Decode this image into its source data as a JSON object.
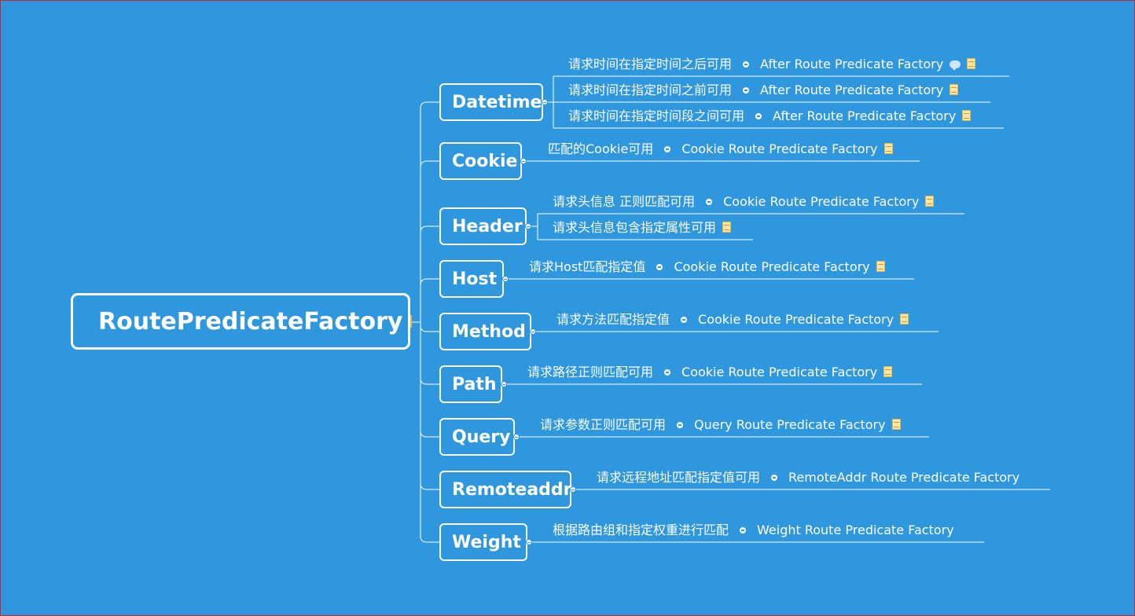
{
  "root": {
    "label": "RoutePredicateFactory",
    "has_note": true
  },
  "branches": [
    {
      "label": "Datetime",
      "items": [
        {
          "text": "请求时间在指定时间之后可用",
          "factory": "After Route Predicate Factory",
          "icons": [
            "comment-icon",
            "note-icon"
          ]
        },
        {
          "text": "请求时间在指定时间之前可用",
          "factory": "After Route Predicate Factory",
          "icons": [
            "note-icon"
          ]
        },
        {
          "text": "请求时间在指定时间段之间可用",
          "factory": "After Route Predicate Factory",
          "icons": [
            "note-icon"
          ]
        }
      ]
    },
    {
      "label": "Cookie",
      "items": [
        {
          "text": "匹配的Cookie可用",
          "factory": "Cookie Route Predicate Factory",
          "icons": [
            "note-icon"
          ]
        }
      ]
    },
    {
      "label": "Header",
      "items": [
        {
          "text": "请求头信息 正则匹配可用",
          "factory": "Cookie Route Predicate Factory",
          "icons": [
            "note-icon"
          ]
        },
        {
          "text": "请求头信息包含指定属性可用",
          "factory": "",
          "icons": [
            "note-icon"
          ]
        }
      ]
    },
    {
      "label": "Host",
      "items": [
        {
          "text": "请求Host匹配指定值",
          "factory": "Cookie Route Predicate Factory",
          "icons": [
            "note-icon"
          ]
        }
      ]
    },
    {
      "label": "Method",
      "items": [
        {
          "text": "请求方法匹配指定值",
          "factory": "Cookie Route Predicate Factory",
          "icons": [
            "note-icon"
          ]
        }
      ]
    },
    {
      "label": "Path",
      "items": [
        {
          "text": "请求路径正则匹配可用",
          "factory": "Cookie Route Predicate Factory",
          "icons": [
            "note-icon"
          ]
        }
      ]
    },
    {
      "label": "Query",
      "items": [
        {
          "text": "请求参数正则匹配可用",
          "factory": "Query Route Predicate Factory",
          "icons": [
            "note-icon"
          ]
        }
      ]
    },
    {
      "label": "Remoteaddr",
      "items": [
        {
          "text": "请求远程地址匹配指定值可用",
          "factory": "RemoteAddr Route Predicate Factory",
          "icons": []
        }
      ]
    },
    {
      "label": "Weight",
      "items": [
        {
          "text": "根据路由组和指定权重进行匹配",
          "factory": "Weight Route Predicate Factory",
          "icons": []
        }
      ]
    }
  ],
  "colors": {
    "background": "#2e97de",
    "line": "#ffffff",
    "frame": "#c0283a"
  }
}
